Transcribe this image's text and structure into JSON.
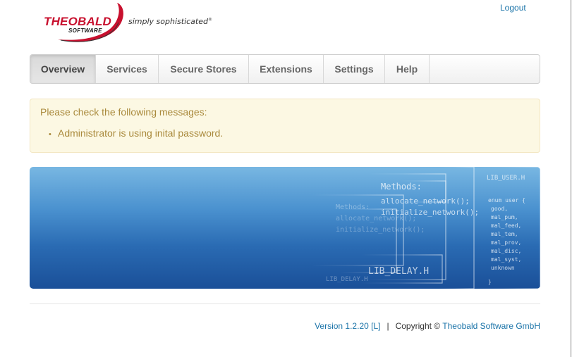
{
  "header": {
    "logo_text": "THEOBALD",
    "logo_subtext": "SOFTWARE",
    "tagline": "simply sophisticated",
    "logout_label": "Logout"
  },
  "nav": {
    "items": [
      {
        "label": "Overview",
        "active": true
      },
      {
        "label": "Services",
        "active": false
      },
      {
        "label": "Secure Stores",
        "active": false
      },
      {
        "label": "Extensions",
        "active": false
      },
      {
        "label": "Settings",
        "active": false
      },
      {
        "label": "Help",
        "active": false
      }
    ]
  },
  "alert": {
    "title": "Please check the following messages:",
    "messages": [
      "Administrator is using inital password."
    ]
  },
  "banner": {
    "texts": [
      "Methods:",
      "allocate_network();",
      "initialize_network();",
      "LIB_DELAY.H",
      "LIB_USER.H",
      "enum user {",
      "good,",
      "mal_pum,",
      "mal_feed,",
      "mal_tem,",
      "mal_prov,",
      "mal_disc,",
      "mal_syst,",
      "unknown",
      "}"
    ]
  },
  "footer": {
    "version": "Version 1.2.20 [L]",
    "separator": "|",
    "copyright_prefix": "Copyright ©",
    "company": "Theobald Software GmbH"
  },
  "colors": {
    "link": "#1a73a8",
    "brand_red": "#c8102e",
    "alert_text": "#a9893b",
    "alert_bg": "#fcf8e3"
  }
}
